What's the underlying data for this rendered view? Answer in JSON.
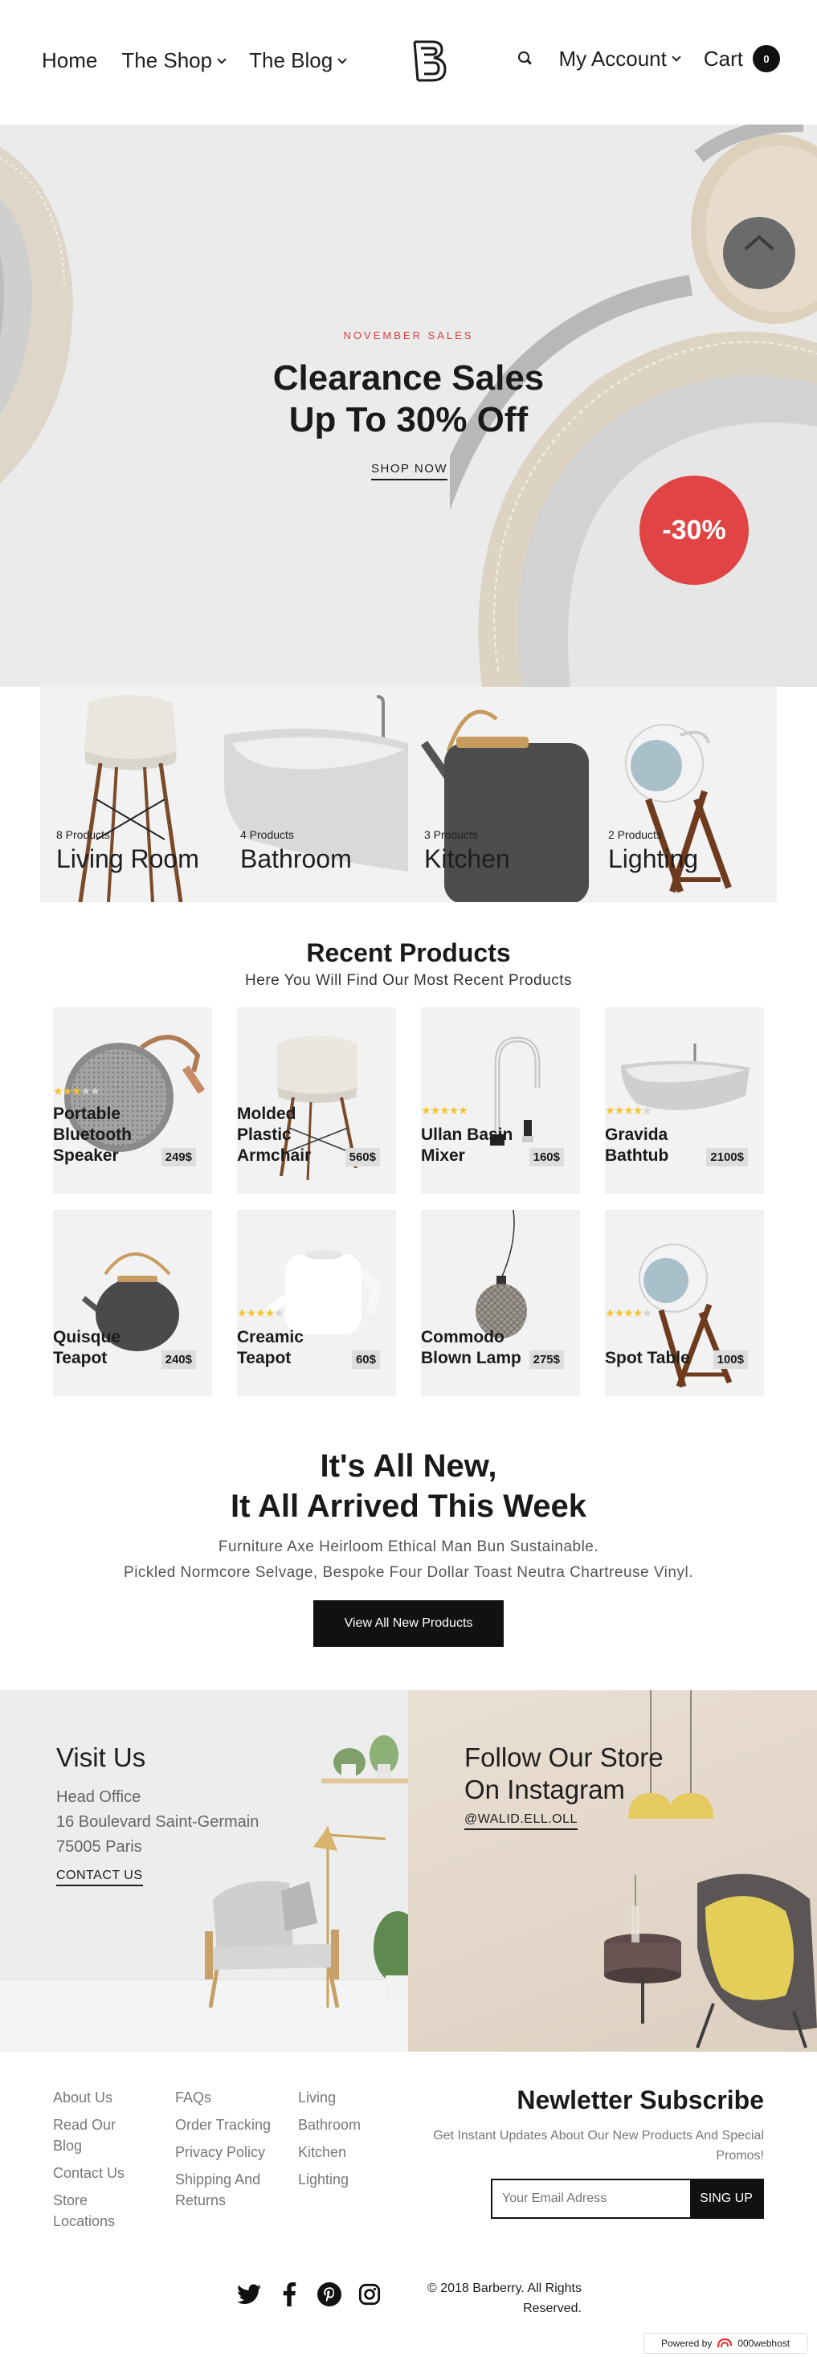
{
  "header": {
    "nav_left": [
      {
        "label": "Home",
        "has_dropdown": false
      },
      {
        "label": "The Shop",
        "has_dropdown": true
      },
      {
        "label": "The Blog",
        "has_dropdown": true
      }
    ],
    "account_label": "My Account",
    "cart_label": "Cart",
    "cart_count": "0"
  },
  "hero": {
    "eyebrow": "NOVEMBER SALES",
    "title_line1": "Clearance Sales",
    "title_line2": "Up To 30% Off",
    "cta": "SHOP NOW",
    "discount": "-30%"
  },
  "categories": [
    {
      "count": "8 Products",
      "name": "Living Room",
      "icon": "chair-image"
    },
    {
      "count": "4 Products",
      "name": "Bathroom",
      "icon": "bathtub-image"
    },
    {
      "count": "3 Products",
      "name": "Kitchen",
      "icon": "teapot-image"
    },
    {
      "count": "2 Products",
      "name": "Lighting",
      "icon": "table-lamp-image"
    }
  ],
  "recent": {
    "title": "Recent Products",
    "subtitle": "Here You Will Find Our Most Recent Products",
    "products": [
      {
        "name": "Portable Bluetooth Speaker",
        "price": "249$",
        "rating": 3,
        "icon": "speaker-image"
      },
      {
        "name": "Molded Plastic Armchair",
        "price": "560$",
        "rating": 0,
        "icon": "armchair-image"
      },
      {
        "name": "Ullan Basin Mixer",
        "price": "160$",
        "rating": 5,
        "icon": "faucet-image"
      },
      {
        "name": "Gravida Bathtub",
        "price": "2100$",
        "rating": 4,
        "icon": "bathtub-image"
      },
      {
        "name": "Quisque Teapot",
        "price": "240$",
        "rating": 0,
        "icon": "teapot-image"
      },
      {
        "name": "Creamic Teapot",
        "price": "60$",
        "rating": 4,
        "icon": "ceramic-teapot-image"
      },
      {
        "name": "Commodo Blown Lamp",
        "price": "275$",
        "rating": 0,
        "icon": "pendant-lamp-image"
      },
      {
        "name": "Spot Table",
        "price": "100$",
        "rating": 4,
        "icon": "spot-lamp-image"
      }
    ]
  },
  "arrivals": {
    "title_line1": "It's All New,",
    "title_line2": "It All Arrived This Week",
    "text_line1": "Furniture Axe Heirloom Ethical Man Bun Sustainable.",
    "text_line2": "Pickled Normcore Selvage, Bespoke Four Dollar Toast Neutra Chartreuse Vinyl.",
    "button": "View All New Products"
  },
  "visit": {
    "title": "Visit Us",
    "line1": "Head Office",
    "line2": "16 Boulevard Saint-Germain",
    "line3": "75005 Paris",
    "link": "CONTACT US"
  },
  "instagram": {
    "title_line1": "Follow Our Store",
    "title_line2": "On Instagram",
    "link": "@WALID.ELL.OLL"
  },
  "footer": {
    "col1": [
      "About Us",
      "Read Our Blog",
      "Contact Us",
      "Store Locations"
    ],
    "col2": [
      "FAQs",
      "Order Tracking",
      "Privacy Policy",
      "Shipping And Returns"
    ],
    "col3": [
      "Living",
      "Bathroom",
      "Kitchen",
      "Lighting"
    ],
    "newsletter_title": "Newletter Subscribe",
    "newsletter_text": "Get Instant Updates About Our New Products And Special Promos!",
    "email_placeholder": "Your Email Adress",
    "signup": "SING UP",
    "socials": [
      "twitter-icon",
      "facebook-icon",
      "pinterest-icon",
      "instagram-icon"
    ],
    "copyright": "© 2018 Barberry. All Rights Reserved.",
    "powered_by": "Powered by",
    "powered_brand": "000webhost"
  },
  "colors": {
    "accent": "#e04444",
    "dark": "#111111",
    "panel": "#f2f2f2",
    "star": "#f4c430"
  }
}
